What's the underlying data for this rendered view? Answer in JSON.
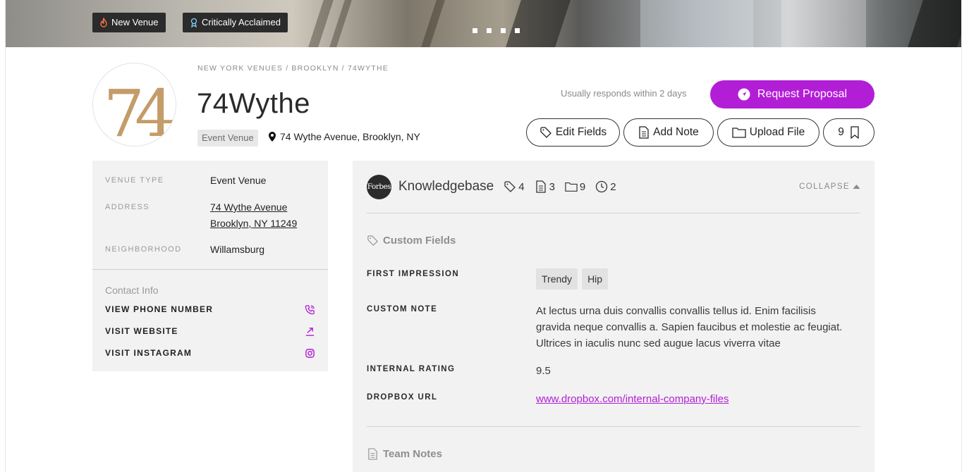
{
  "hero": {
    "badges": [
      {
        "label": "New Venue",
        "icon": "flame-icon"
      },
      {
        "label": "Critically Acclaimed",
        "icon": "award-icon"
      }
    ],
    "slide_count": 4
  },
  "header": {
    "breadcrumb": "NEW YORK VENUES / BROOKLYN / 74WYTHE",
    "title": "74Wythe",
    "logo_text": "74",
    "venue_tag": "Event Venue",
    "address": "74 Wythe Avenue, Brooklyn, NY",
    "responds_text": "Usually responds within 2 days",
    "request_label": "Request Proposal",
    "actions": {
      "edit_fields": "Edit Fields",
      "add_note": "Add Note",
      "upload_file": "Upload File",
      "bookmark_count": "9"
    }
  },
  "info": {
    "rows": [
      {
        "label": "VENUE TYPE",
        "value": "Event Venue"
      },
      {
        "label": "ADDRESS",
        "value_line1": "74 Wythe Avenue",
        "value_line2": "Brooklyn, NY 11249"
      },
      {
        "label": "NEIGHBORHOOD",
        "value": "Willamsburg"
      }
    ],
    "contact_title": "Contact Info",
    "contacts": [
      {
        "label": "VIEW PHONE NUMBER",
        "icon": "phone-icon"
      },
      {
        "label": "VISIT WEBSITE",
        "icon": "external-link-icon"
      },
      {
        "label": "VISIT INSTAGRAM",
        "icon": "instagram-icon"
      }
    ]
  },
  "knowledgebase": {
    "logo_text": "Forbes",
    "title": "Knowledgebase",
    "stats": {
      "tags": "4",
      "notes": "3",
      "files": "9",
      "history": "2"
    },
    "collapse_label": "COLLAPSE",
    "custom_fields_title": "Custom Fields",
    "fields": {
      "first_impression_label": "FIRST IMPRESSION",
      "first_impression_chips": [
        "Trendy",
        "Hip"
      ],
      "custom_note_label": "CUSTOM NOTE",
      "custom_note_value": "At lectus urna duis convallis convallis tellus id. Enim facilisis gravida neque convallis a. Sapien faucibus et molestie ac feugiat. Ultrices in iaculis nunc sed augue lacus viverra vitae",
      "internal_rating_label": "INTERNAL RATING",
      "internal_rating_value": "9.5",
      "dropbox_label": "DROPBOX URL",
      "dropbox_value": "www.dropbox.com/internal-company-files"
    },
    "team_notes_title": "Team Notes"
  },
  "colors": {
    "accent": "#b21ed6",
    "panel_bg": "#f2f2f2",
    "logo_gold": "#c39c68"
  }
}
